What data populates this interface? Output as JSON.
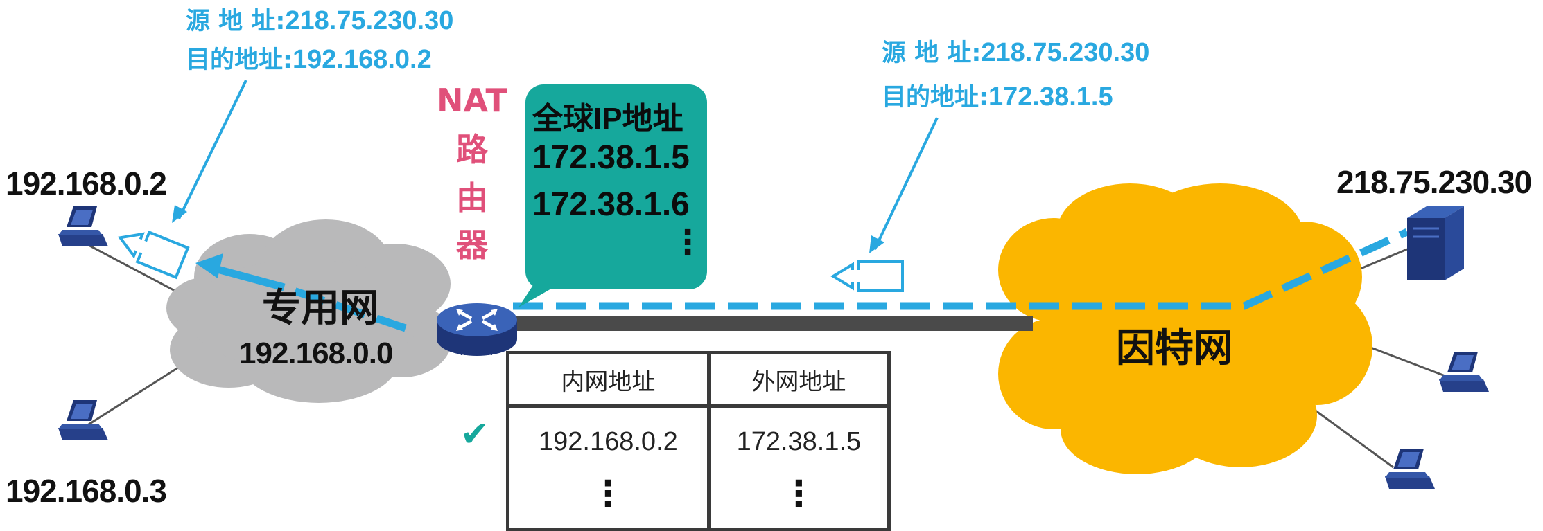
{
  "left_packet": {
    "src_label": "源 地 址:",
    "src_value": "218.75.230.30",
    "dst_label": "目的地址:",
    "dst_value": "192.168.0.2"
  },
  "right_packet": {
    "src_label": "源 地 址:",
    "src_value": "218.75.230.30",
    "dst_label": "目的地址:",
    "dst_value": "172.38.1.5"
  },
  "nat_router": {
    "label_lines": [
      "NAT",
      "路",
      "由",
      "器"
    ],
    "icon_text": "ROUTER",
    "bubble_title": "全球IP地址",
    "global_ips": [
      "172.38.1.5",
      "172.38.1.6"
    ],
    "bubble_more": "⋮"
  },
  "private_network": {
    "title": "专用网",
    "address": "192.168.0.0",
    "hosts": [
      "192.168.0.2",
      "192.168.0.3"
    ]
  },
  "internet": {
    "title": "因特网",
    "server_address": "218.75.230.30"
  },
  "nat_table": {
    "headers": [
      "内网地址",
      "外网地址"
    ],
    "rows": [
      [
        "192.168.0.2",
        "172.38.1.5"
      ]
    ],
    "more_symbol": "⋮",
    "active_mark": "✔"
  },
  "colors": {
    "flow_blue": "#29a8e0",
    "nat_pink": "#e0507a",
    "bubble_teal": "#16a89c",
    "internet_orange": "#fbb600",
    "private_gray": "#b9b9ba",
    "link_gray": "#4a4a4a",
    "device_navy": "#1e3578"
  },
  "icons": [
    "desktop-computer-icon",
    "server-icon",
    "router-icon",
    "packet-arrow-icon",
    "checkmark-icon"
  ]
}
